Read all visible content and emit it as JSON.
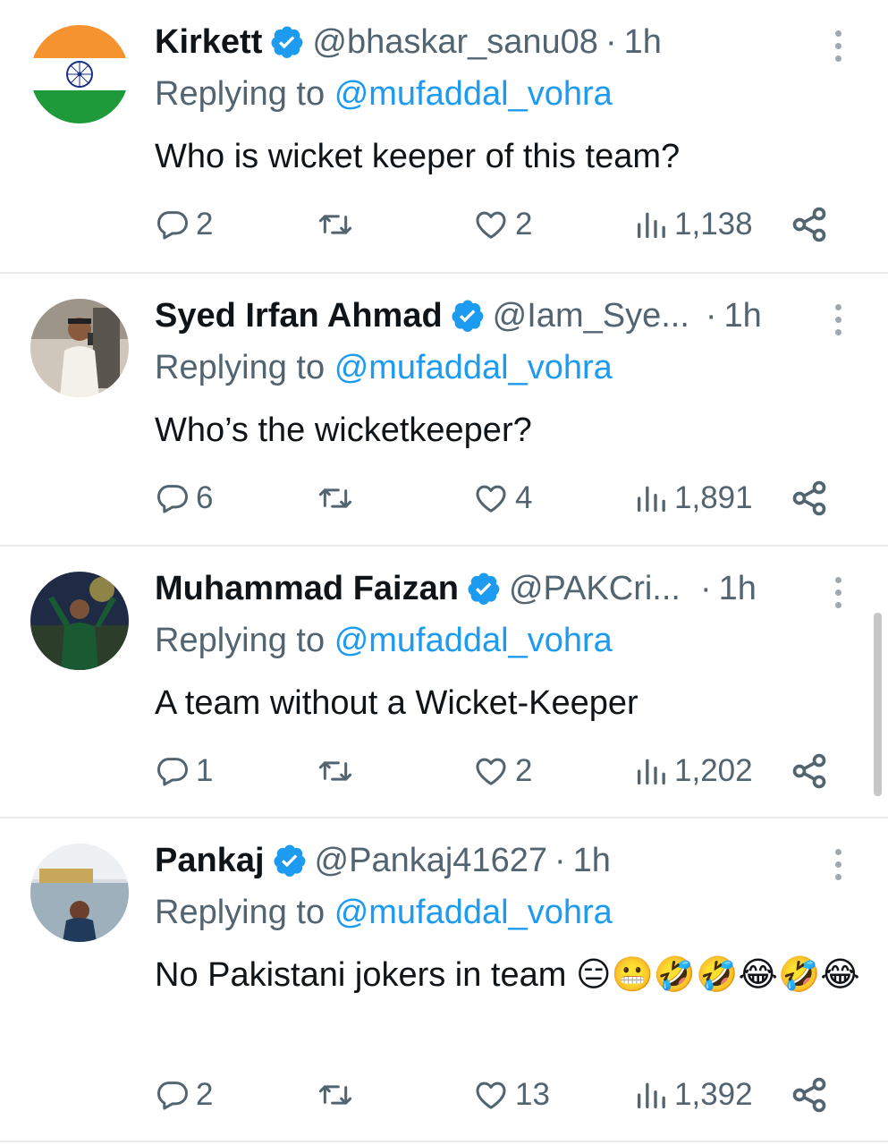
{
  "tweets": [
    {
      "name": "Kirkett",
      "handle": "@bhaskar_sanu08",
      "time": "1h",
      "replying_prefix": "Replying to",
      "replying_to": "@mufaddal_vohra",
      "text": "Who is wicket keeper of this team?",
      "emojis": "",
      "replies": "2",
      "retweets": "",
      "likes": "2",
      "views": "1,138"
    },
    {
      "name": "Syed Irfan Ahmad",
      "handle": "@Iam_Sye...",
      "time": "1h",
      "replying_prefix": "Replying to",
      "replying_to": "@mufaddal_vohra",
      "text": "Who’s the wicketkeeper?",
      "emojis": "",
      "replies": "6",
      "retweets": "",
      "likes": "4",
      "views": "1,891"
    },
    {
      "name": "Muhammad Faizan",
      "handle": "@PAKCri...",
      "time": "1h",
      "replying_prefix": "Replying to",
      "replying_to": "@mufaddal_vohra",
      "text": "A team without a Wicket-Keeper",
      "emojis": "",
      "replies": "1",
      "retweets": "",
      "likes": "2",
      "views": "1,202"
    },
    {
      "name": "Pankaj",
      "handle": "@Pankaj41627",
      "time": "1h",
      "replying_prefix": "Replying to",
      "replying_to": "@mufaddal_vohra",
      "text": "No Pakistani jokers in team",
      "emojis": "😑😬🤣🤣😂🤣😂",
      "replies": "2",
      "retweets": "",
      "likes": "13",
      "views": "1,392"
    }
  ],
  "colors": {
    "verified": "#1d9bf0",
    "mention": "#1d9bf0",
    "secondary_text": "#536471",
    "divider": "#e7e9ea"
  },
  "icons": [
    "verified-badge-icon",
    "more-icon",
    "reply-icon",
    "retweet-icon",
    "like-icon",
    "views-icon",
    "share-icon"
  ]
}
